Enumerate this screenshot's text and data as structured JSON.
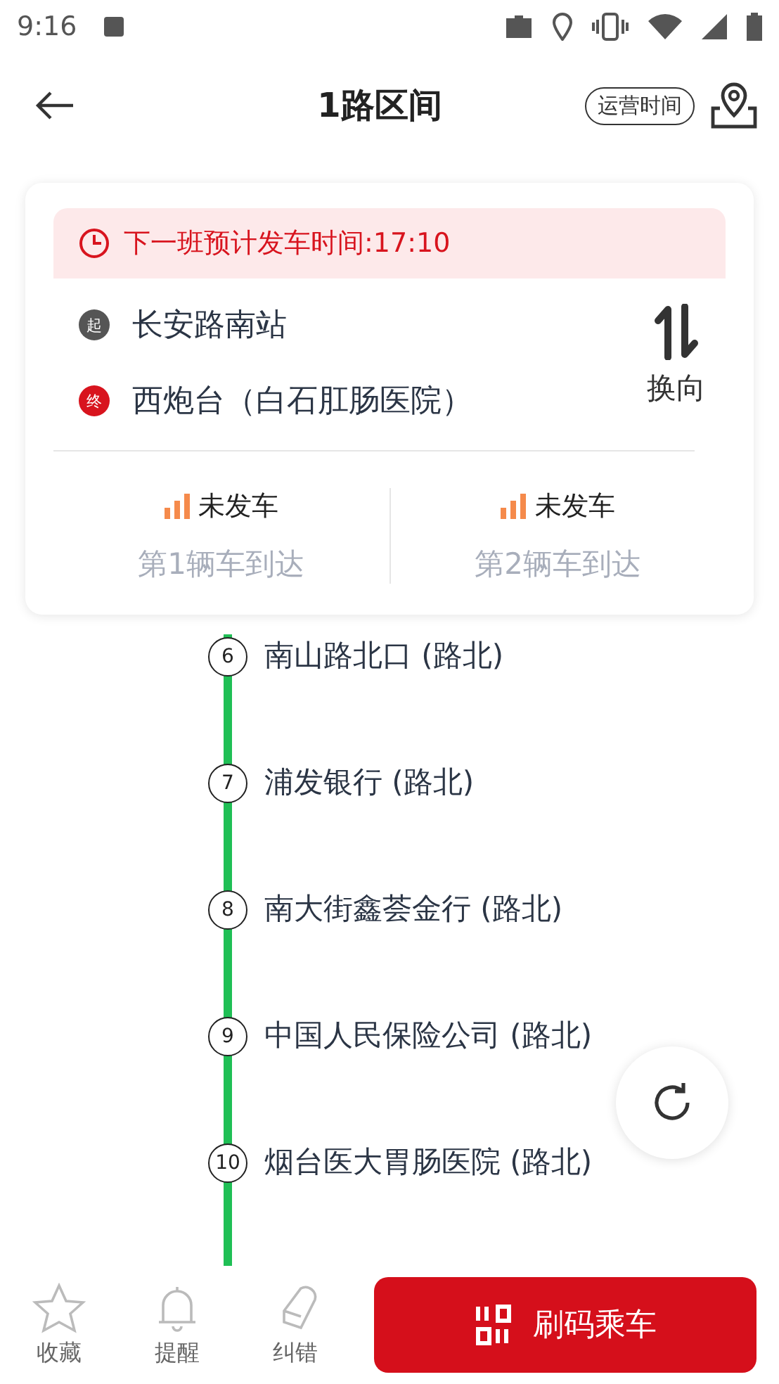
{
  "status_bar": {
    "time": "9:16"
  },
  "header": {
    "title": "1路区间",
    "hours_button": "运营时间"
  },
  "notice": {
    "text": "下一班预计发车时间:17:10"
  },
  "route": {
    "start_badge": "起",
    "start": "长安路南站",
    "end_badge": "终",
    "end": "西炮台（白石肛肠医院）",
    "switch_label": "换向"
  },
  "buses": [
    {
      "status": "未发车",
      "label": "第1辆车到达"
    },
    {
      "status": "未发车",
      "label": "第2辆车到达"
    }
  ],
  "stops": [
    {
      "number": "6",
      "name": "南山路北口 (路北)"
    },
    {
      "number": "7",
      "name": "浦发银行 (路北)"
    },
    {
      "number": "8",
      "name": "南大街鑫荟金行 (路北)"
    },
    {
      "number": "9",
      "name": "中国人民保险公司 (路北)"
    },
    {
      "number": "10",
      "name": "烟台医大胃肠医院 (路北)"
    }
  ],
  "bottom_bar": {
    "actions": [
      {
        "kind": "star",
        "label": "收藏"
      },
      {
        "kind": "bell",
        "label": "提醒"
      },
      {
        "kind": "pencil",
        "label": "纠错"
      }
    ],
    "scan_button": "刷码乘车"
  }
}
